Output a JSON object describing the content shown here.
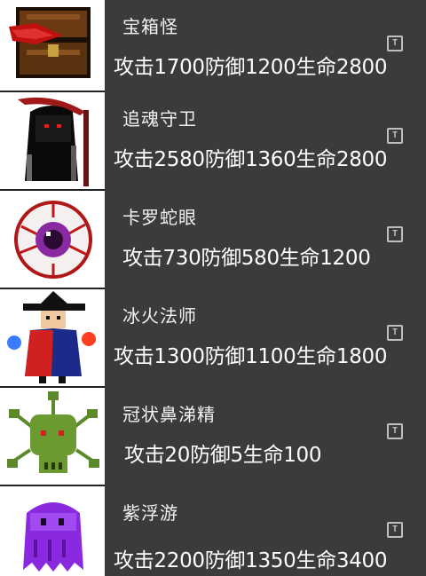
{
  "monsters": [
    {
      "name": "宝箱怪",
      "stats": "攻击1700防御1200生命2800",
      "icon": "chest-mimic-icon"
    },
    {
      "name": "追魂守卫",
      "stats": "攻击2580防御1360生命2800",
      "icon": "reaper-icon"
    },
    {
      "name": "卡罗蛇眼",
      "stats": "攻击730防御580生命1200",
      "icon": "eyeball-icon"
    },
    {
      "name": "冰火法师",
      "stats": "攻击1300防御1100生命1800",
      "icon": "wizard-icon"
    },
    {
      "name": "冠状鼻涕精",
      "stats": "攻击20防御5生命100",
      "icon": "virus-slime-icon"
    },
    {
      "name": "紫浮游",
      "stats": "攻击2200防御1350生命3400",
      "icon": "purple-ghost-icon"
    }
  ],
  "text_button_label": "T",
  "colors": {
    "panel": "#3b3b3b",
    "text": "#ffffff",
    "portrait_bg": "#ffffff"
  }
}
